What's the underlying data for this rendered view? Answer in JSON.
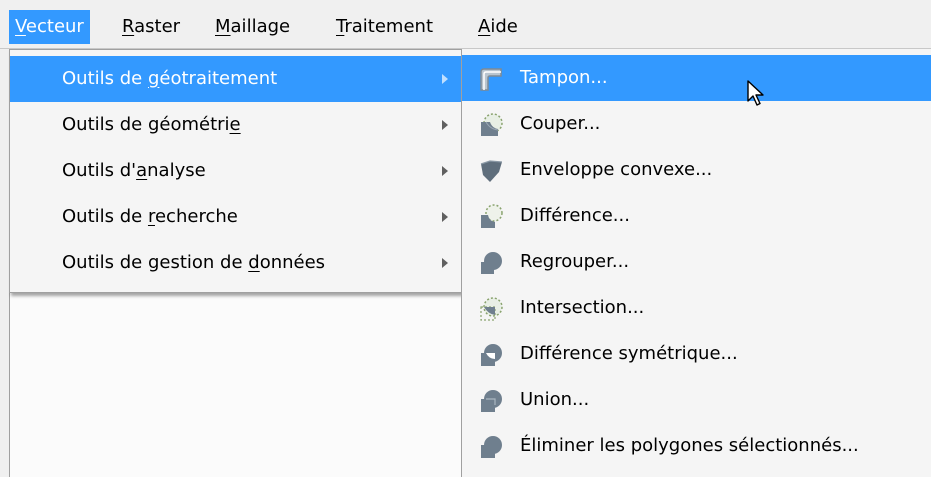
{
  "menubar": {
    "items": [
      {
        "pre": "",
        "mnemonic": "V",
        "post": "ecteur"
      },
      {
        "pre": "",
        "mnemonic": "R",
        "post": "aster"
      },
      {
        "pre": "",
        "mnemonic": "M",
        "post": "aillage"
      },
      {
        "pre": "",
        "mnemonic": "T",
        "post": "raitement"
      },
      {
        "pre": "",
        "mnemonic": "A",
        "post": "ide"
      }
    ],
    "active_item": "Vecteur"
  },
  "vector_menu": {
    "items": [
      {
        "pre": "Outils de ",
        "mnemonic": "g",
        "post": "éotraitement",
        "has_submenu": true
      },
      {
        "pre": "Outils de géométri",
        "mnemonic": "e",
        "post": "",
        "has_submenu": true
      },
      {
        "pre": "Outils d'",
        "mnemonic": "a",
        "post": "nalyse",
        "has_submenu": true
      },
      {
        "pre": "Outils de ",
        "mnemonic": "r",
        "post": "echerche",
        "has_submenu": true
      },
      {
        "pre": "Outils de gestion de ",
        "mnemonic": "d",
        "post": "onnées",
        "has_submenu": true
      }
    ],
    "active_item": "Outils de géotraitement"
  },
  "geoprocessing_menu": {
    "items": [
      {
        "label": "Tampon...",
        "icon": "buffer-icon"
      },
      {
        "label": "Couper...",
        "icon": "clip-icon"
      },
      {
        "label": "Enveloppe convexe...",
        "icon": "convex-hull-icon"
      },
      {
        "label": "Différence...",
        "icon": "difference-icon"
      },
      {
        "label": "Regrouper...",
        "icon": "dissolve-icon"
      },
      {
        "label": "Intersection...",
        "icon": "intersection-icon"
      },
      {
        "label": "Différence symétrique...",
        "icon": "symmetric-difference-icon"
      },
      {
        "label": "Union...",
        "icon": "union-icon"
      },
      {
        "label": "Éliminer les polygones sélectionnés...",
        "icon": "eliminate-polygons-icon"
      }
    ],
    "active_item": "Tampon..."
  },
  "colors": {
    "highlight": "#3399ff",
    "menu_background": "#f5f5f5",
    "icon_gray": "#6b7c8c"
  }
}
